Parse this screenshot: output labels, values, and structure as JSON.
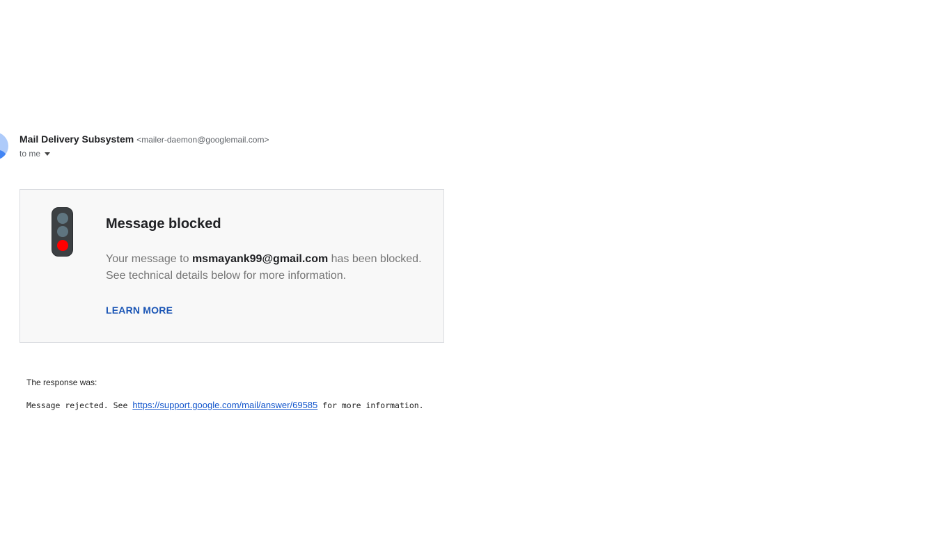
{
  "sender": {
    "name": "Mail Delivery Subsystem",
    "email": "<mailer-daemon@googlemail.com>",
    "avatar_icon": "person-icon",
    "avatar_color": "#aecbfa"
  },
  "recipient": {
    "label": "to me",
    "dropdown_icon": "caret-down-icon"
  },
  "notice": {
    "icon": "traffic-light-icon",
    "title": "Message blocked",
    "message_prefix": "Your message to ",
    "recipient_address": "msmayank99@gmail.com",
    "message_suffix": " has been blocked. See technical details below for more information.",
    "learn_more_label": "LEARN MORE",
    "link_color": "#1a55b5",
    "alert_color": "#ff0000"
  },
  "technical": {
    "response_label": "The response was:",
    "response_prefix": "Message rejected. See ",
    "response_link": "https://support.google.com/mail/answer/69585",
    "response_suffix": " for more information."
  }
}
